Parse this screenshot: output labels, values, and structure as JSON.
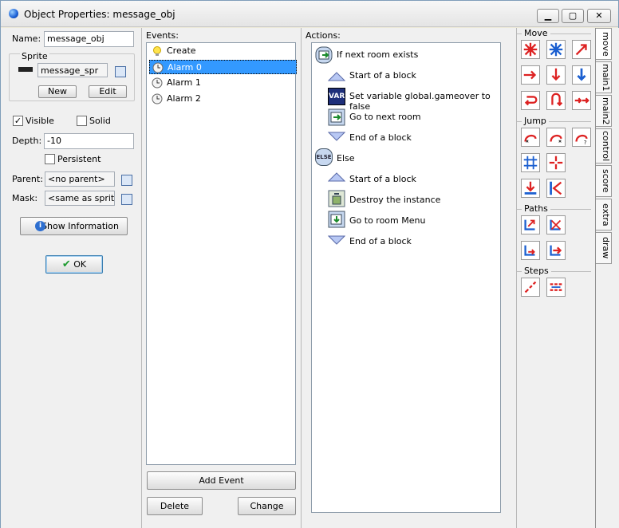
{
  "window": {
    "title": "Object Properties: message_obj",
    "min_label": "▁",
    "max_label": "▢",
    "close_label": "✕"
  },
  "left": {
    "name_label": "Name:",
    "name_value": "message_obj",
    "sprite_label": "Sprite",
    "sprite_value": "message_spr",
    "new_label": "New",
    "edit_label": "Edit",
    "visible_label": "Visible",
    "visible_checked": "✓",
    "solid_label": "Solid",
    "depth_label": "Depth:",
    "depth_value": "-10",
    "persistent_label": "Persistent",
    "parent_label": "Parent:",
    "parent_value": "<no parent>",
    "mask_label": "Mask:",
    "mask_value": "<same as sprite>",
    "show_info_label": "Show Information",
    "ok_label": "OK"
  },
  "events": {
    "label": "Events:",
    "items": [
      "Create",
      "Alarm 0",
      "Alarm 1",
      "Alarm 2"
    ],
    "add_event_label": "Add Event",
    "delete_label": "Delete",
    "change_label": "Change"
  },
  "actions": {
    "label": "Actions:",
    "items": [
      "If next room exists",
      "Start of a block",
      "Set variable global.gameover to false",
      "Go to next room",
      "End of a block",
      "Else",
      "Start of a block",
      "Destroy the instance",
      "Go to room Menu",
      "End of a block"
    ],
    "var_text": "VAR",
    "else_text": "ELSE"
  },
  "palette": {
    "sections": [
      "Move",
      "Jump",
      "Paths",
      "Steps"
    ]
  },
  "tabs": [
    "move",
    "main1",
    "main2",
    "control",
    "score",
    "extra",
    "draw"
  ]
}
